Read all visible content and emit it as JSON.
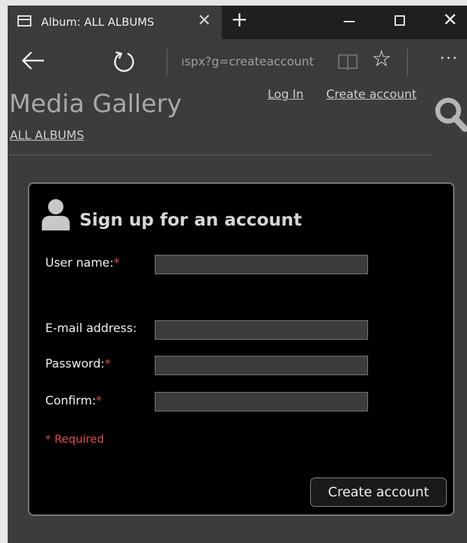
{
  "browser": {
    "tab_title": "Album: ALL ALBUMS",
    "address": "ıspx?g=createaccount"
  },
  "header": {
    "site_title": "Media Gallery",
    "login_label": "Log In",
    "create_account_label": "Create account",
    "breadcrumb": "ALL ALBUMS"
  },
  "form": {
    "title": "Sign up for an account",
    "fields": [
      {
        "label": "User name:",
        "required": true,
        "value": ""
      },
      {
        "label": "E-mail address:",
        "required": false,
        "value": ""
      },
      {
        "label": "Password:",
        "required": true,
        "value": ""
      },
      {
        "label": "Confirm:",
        "required": true,
        "value": ""
      }
    ],
    "required_marker": "*",
    "required_note": "* Required",
    "submit_label": "Create account"
  },
  "colors": {
    "page_background": "#3c3c3c",
    "card_background": "#000000",
    "required_red": "#e04848"
  }
}
